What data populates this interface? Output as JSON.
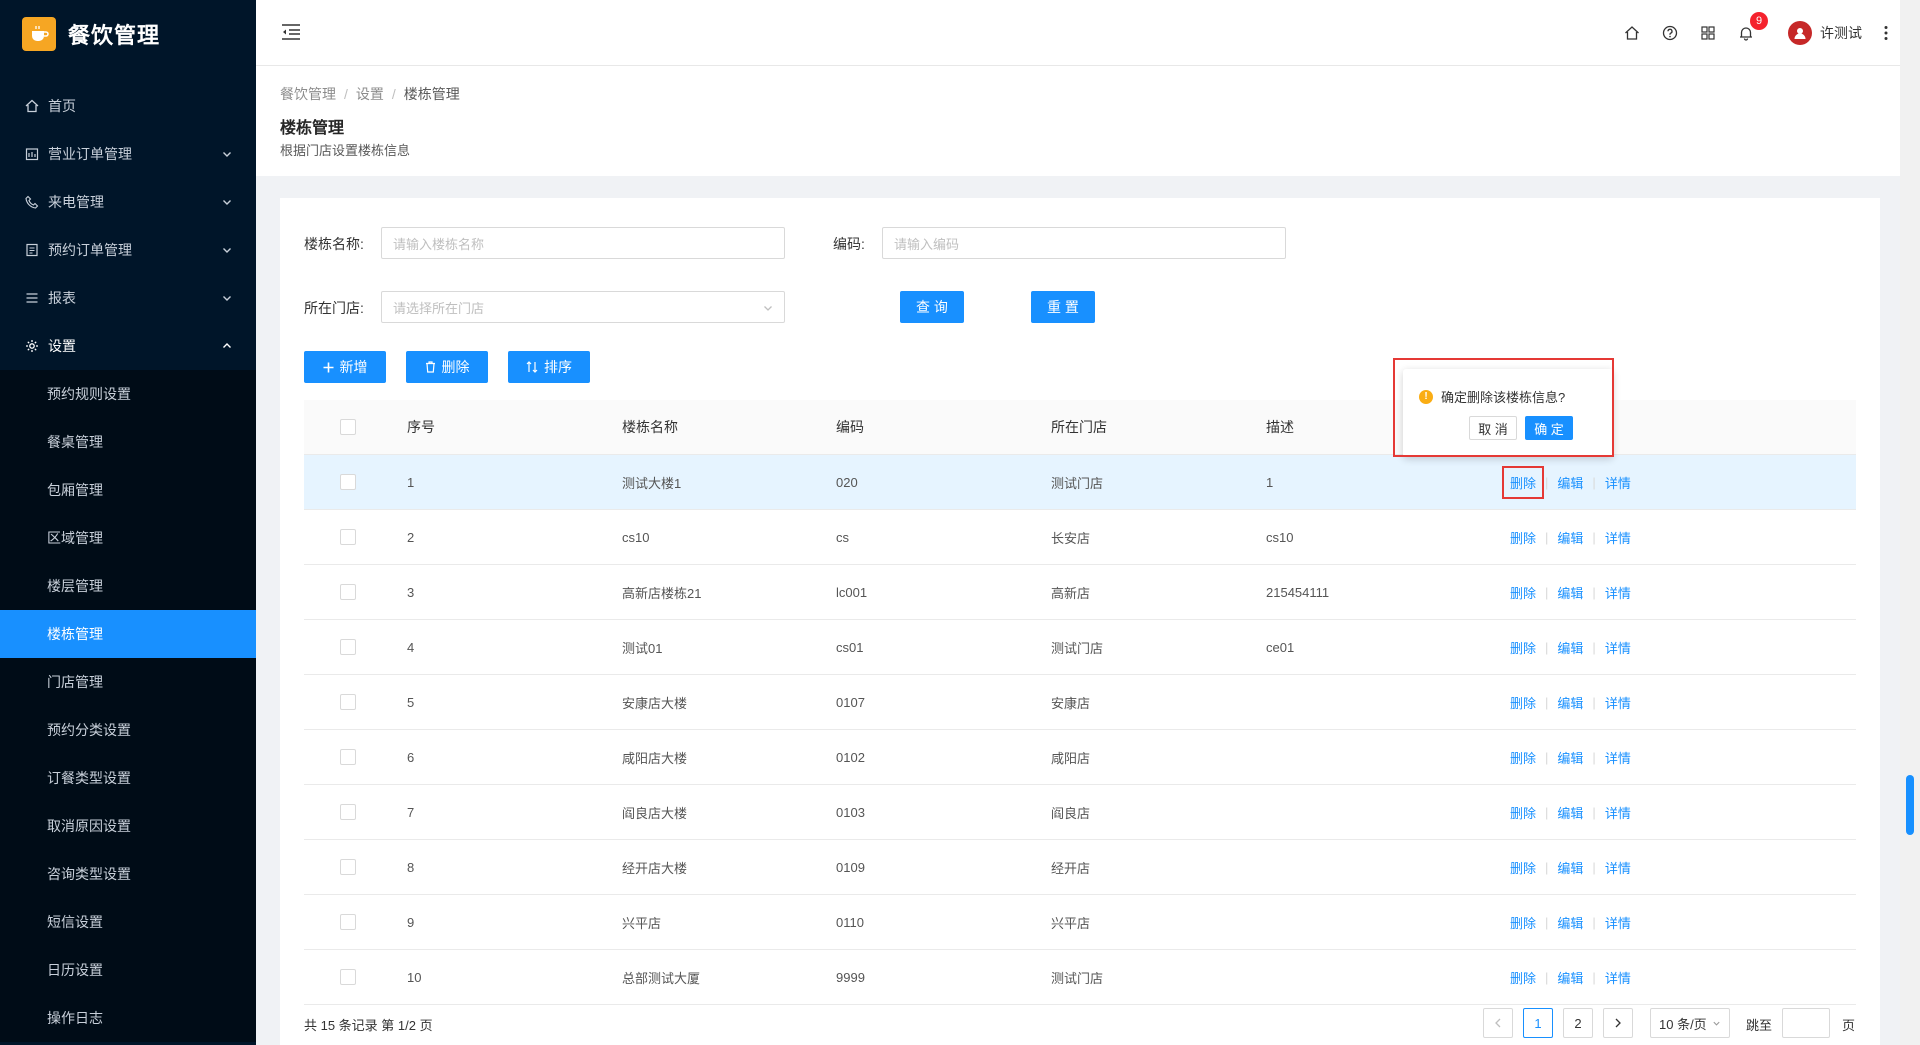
{
  "app": {
    "title": "餐饮管理",
    "logo_icon": "cup-logo-icon"
  },
  "sidebar": {
    "items": [
      {
        "label": "首页",
        "icon": "home-icon"
      },
      {
        "label": "营业订单管理",
        "icon": "calendar-icon"
      },
      {
        "label": "来电管理",
        "icon": "phone-icon"
      },
      {
        "label": "预约订单管理",
        "icon": "list-icon"
      },
      {
        "label": "报表",
        "icon": "menu-icon"
      },
      {
        "label": "设置",
        "icon": "gear-icon"
      }
    ],
    "sub_items": [
      "预约规则设置",
      "餐桌管理",
      "包厢管理",
      "区域管理",
      "楼层管理",
      "楼栋管理",
      "门店管理",
      "预约分类设置",
      "订餐类型设置",
      "取消原因设置",
      "咨询类型设置",
      "短信设置",
      "日历设置",
      "操作日志"
    ],
    "selected": "楼栋管理"
  },
  "header": {
    "notification_count": "9",
    "username": "许测试"
  },
  "breadcrumb": [
    "餐饮管理",
    "设置",
    "楼栋管理"
  ],
  "page": {
    "title": "楼栋管理",
    "subtitle": "根据门店设置楼栋信息"
  },
  "filters": {
    "name_label": "楼栋名称:",
    "name_placeholder": "请输入楼栋名称",
    "code_label": "编码:",
    "code_placeholder": "请输入编码",
    "store_label": "所在门店:",
    "store_placeholder": "请选择所在门店",
    "query_label": "查 询",
    "reset_label": "重 置"
  },
  "toolbar": {
    "add_label": "新增",
    "delete_label": "删除",
    "sort_label": "排序"
  },
  "table": {
    "headers": [
      "序号",
      "楼栋名称",
      "编码",
      "所在门店",
      "描述"
    ],
    "rows": [
      {
        "no": "1",
        "name": "测试大楼1",
        "code": "020",
        "store": "测试门店",
        "desc": "1"
      },
      {
        "no": "2",
        "name": "cs10",
        "code": "cs",
        "store": "长安店",
        "desc": "cs10"
      },
      {
        "no": "3",
        "name": "高新店楼栋21",
        "code": "lc001",
        "store": "高新店",
        "desc": "215454111"
      },
      {
        "no": "4",
        "name": "测试01",
        "code": "cs01",
        "store": "测试门店",
        "desc": "ce01"
      },
      {
        "no": "5",
        "name": "安康店大楼",
        "code": "0107",
        "store": "安康店",
        "desc": ""
      },
      {
        "no": "6",
        "name": "咸阳店大楼",
        "code": "0102",
        "store": "咸阳店",
        "desc": ""
      },
      {
        "no": "7",
        "name": "阎良店大楼",
        "code": "0103",
        "store": "阎良店",
        "desc": ""
      },
      {
        "no": "8",
        "name": "经开店大楼",
        "code": "0109",
        "store": "经开店",
        "desc": ""
      },
      {
        "no": "9",
        "name": "兴平店",
        "code": "0110",
        "store": "兴平店",
        "desc": ""
      },
      {
        "no": "10",
        "name": "总部测试大厦",
        "code": "9999",
        "store": "测试门店",
        "desc": ""
      }
    ],
    "actions": {
      "delete": "删除",
      "edit": "编辑",
      "detail": "详情"
    }
  },
  "popconfirm": {
    "message": "确定删除该楼栋信息?",
    "cancel": "取 消",
    "ok": "确 定"
  },
  "footer": {
    "total_text": "共 15 条记录 第 1/2 页",
    "pages": [
      "1",
      "2"
    ],
    "page_size": "10 条/页",
    "jump_label": "跳至",
    "page_unit": "页"
  },
  "colors": {
    "primary": "#1890ff",
    "sidebar_bg": "#001529",
    "danger_outline": "#e53935",
    "badge": "#f5222d",
    "logo": "#f6a623"
  }
}
